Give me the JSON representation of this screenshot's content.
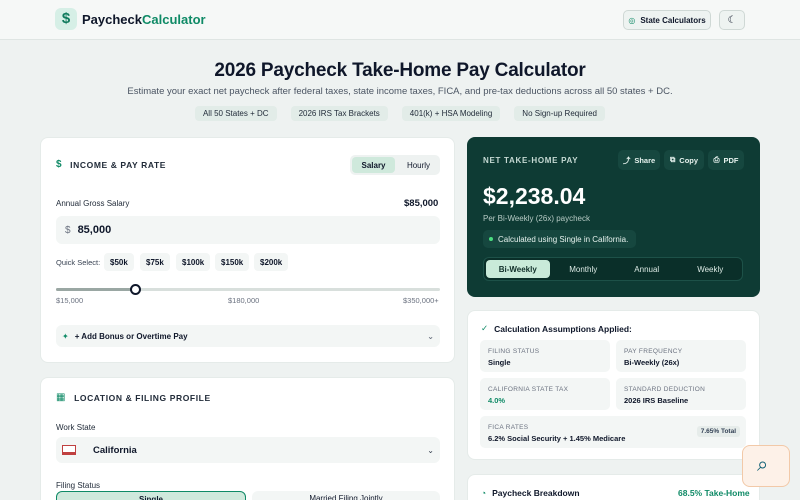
{
  "header": {
    "logo_icon": "$",
    "brand_prefix": "Paycheck",
    "brand_accent": "Calculator",
    "state_button": "State Calculators",
    "theme_toggle_icon": "moon-icon"
  },
  "hero": {
    "title": "2026 Paycheck Take-Home Pay Calculator",
    "subtitle": "Estimate your exact net paycheck after federal taxes, state income taxes, FICA, and pre-tax deductions across all 50 states + DC.",
    "pills": [
      "All 50 States + DC",
      "2026 IRS Tax Brackets",
      "401(k) + HSA Modeling",
      "No Sign-up Required"
    ]
  },
  "income": {
    "title": "INCOME & PAY RATE",
    "tabs": [
      "Salary",
      "Hourly"
    ],
    "salary_label": "Annual Gross Salary",
    "salary_display": "$85,000",
    "currency": "$",
    "salary_input": "85,000",
    "quick_select_label": "Quick Select:",
    "quick_select": [
      "$50k",
      "$75k",
      "$100k",
      "$150k",
      "$200k"
    ],
    "slider": {
      "min_label": "$15,000",
      "mid_label": "$180,000",
      "max_label": "$350,000+",
      "value": 85000,
      "min": 15000,
      "max": 350000
    },
    "bonus_label": "+ Add Bonus or Overtime Pay"
  },
  "location": {
    "title": "LOCATION & FILING PROFILE",
    "work_state_label": "Work State",
    "work_state": "California",
    "filing_status_label": "Filing Status",
    "filing_options": [
      "Single",
      "Married Filing Jointly"
    ]
  },
  "net": {
    "title": "NET TAKE-HOME PAY",
    "share": "Share",
    "copy": "Copy",
    "pdf": "PDF",
    "amount": "$2,238.04",
    "per_label": "Per Bi-Weekly (26x) paycheck",
    "calc_note": "Calculated using Single in California.",
    "frequencies": [
      "Bi-Weekly",
      "Monthly",
      "Annual",
      "Weekly"
    ]
  },
  "assumptions": {
    "title": "Calculation Assumptions Applied:",
    "filing_status_key": "FILING STATUS",
    "filing_status_val": "Single",
    "pay_frequency_key": "PAY FREQUENCY",
    "pay_frequency_val": "Bi-Weekly (26x)",
    "state_tax_key": "CALIFORNIA STATE TAX",
    "state_tax_val": "4.0%",
    "std_deduction_key": "STANDARD DEDUCTION",
    "std_deduction_val": "2026 IRS Baseline",
    "fica_key": "FICA RATES",
    "fica_val": "6.2% Social Security + 1.45% Medicare",
    "fica_total": "7.65% Total"
  },
  "breakdown": {
    "title": "Paycheck Breakdown",
    "value": "68.5% Take-Home"
  },
  "colors": {
    "brand": "#0f8a66",
    "dark_card": "#0e3b34",
    "page_bg": "#eef2f1"
  }
}
